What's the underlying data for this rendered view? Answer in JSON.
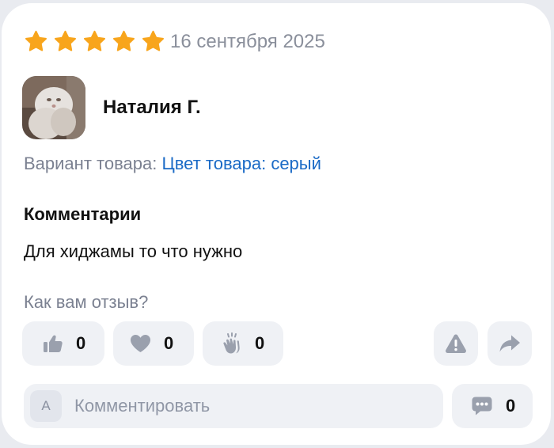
{
  "review": {
    "rating": 5,
    "rating_max": 5,
    "date": "16 сентября 2025",
    "author": "Наталия Г.",
    "variant_label": "Вариант товара:",
    "variant_value": "Цвет товара: серый",
    "comments_title": "Комментарии",
    "comment_text": "Для хиджамы то что нужно"
  },
  "reactions": {
    "prompt": "Как вам отзыв?",
    "like_count": "0",
    "heart_count": "0",
    "clap_count": "0"
  },
  "comment_input": {
    "avatar_letter": "А",
    "placeholder": "Комментировать",
    "comments_count": "0"
  },
  "colors": {
    "star": "#f8a51c",
    "link": "#1a6ac6",
    "muted": "#7b8191",
    "pill_bg": "#eff1f5",
    "icon": "#9aa0ad"
  },
  "icons": [
    "star-icon",
    "thumbs-up-icon",
    "heart-icon",
    "clap-icon",
    "warning-icon",
    "share-icon",
    "comment-bubble-icon"
  ]
}
